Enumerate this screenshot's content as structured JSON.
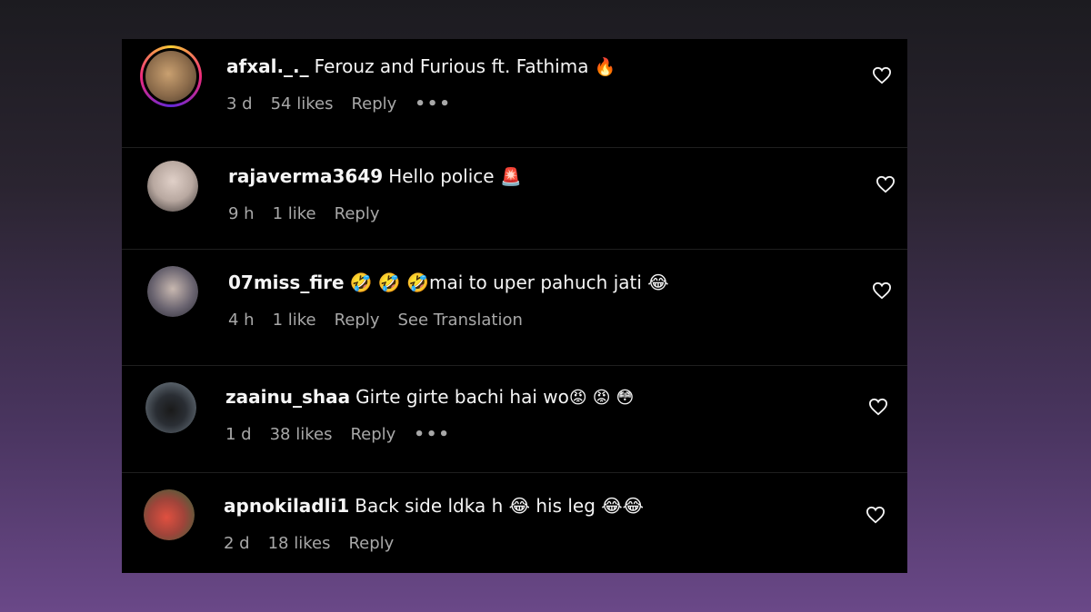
{
  "comments": [
    {
      "username": "afxal._._",
      "text": "Ferouz and Furious ft. Fathima",
      "emoji": "🔥",
      "time": "3 d",
      "likes": "54 likes",
      "reply": "Reply",
      "more": "•••",
      "avatar_color": "#8a6a4a"
    },
    {
      "username": "rajaverma3649",
      "text": "Hello police",
      "emoji": "🚨",
      "time": "9 h",
      "likes": "1 like",
      "reply": "Reply",
      "avatar_color": "#b8a8a0"
    },
    {
      "username": "07miss_fire",
      "text": "🤣 🤣 🤣mai to uper pahuch jati 😂",
      "time": "4 h",
      "likes": "1 like",
      "reply": "Reply",
      "translation": "See Translation",
      "avatar_color": "#6a6470"
    },
    {
      "username": "zaainu_shaa",
      "text": "Girte girte bachi hai wo",
      "emoji": "😡 😡 😳",
      "time": "1 d",
      "likes": "38 likes",
      "reply": "Reply",
      "more": "•••",
      "avatar_color": "#4a5660"
    },
    {
      "username": "apnokiladli1",
      "text": "Back side ldka h 😂 his leg 😂😂",
      "time": "2 d",
      "likes": "18 likes",
      "reply": "Reply",
      "avatar_color": "#a0443a"
    }
  ]
}
